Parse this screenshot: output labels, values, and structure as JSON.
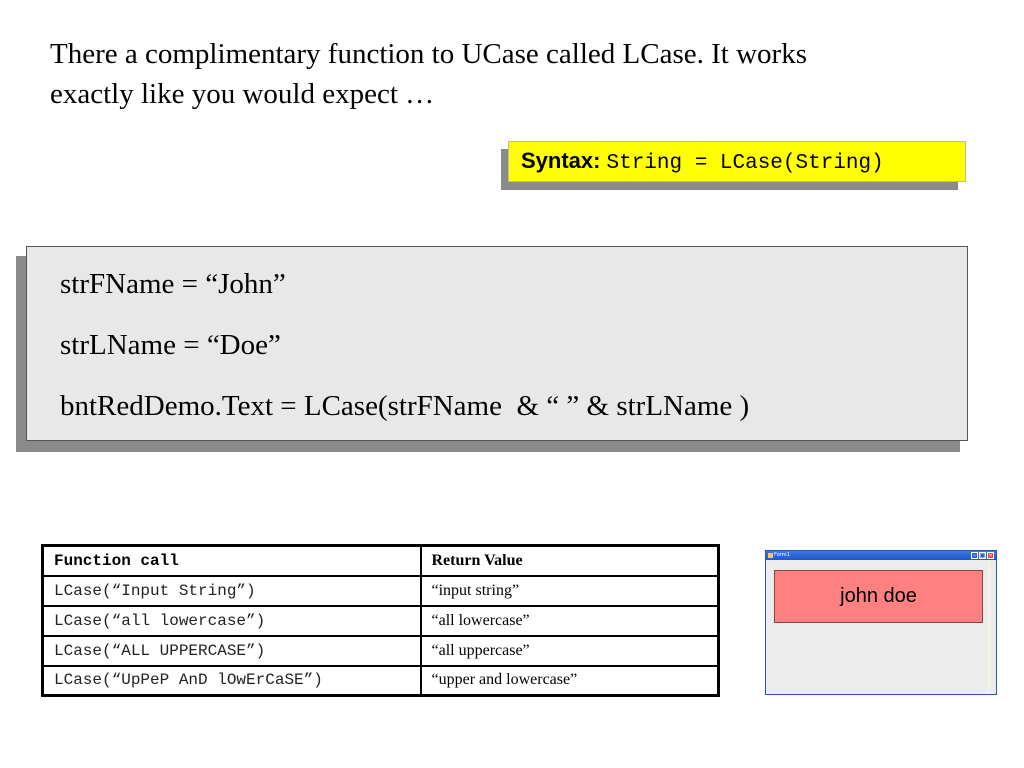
{
  "intro": {
    "line1": "There a complimentary function to UCase called LCase. It works",
    "line2": "exactly like you would expect …"
  },
  "syntax": {
    "label": "Syntax:",
    "code": "String = LCase(String)",
    "background_color": "#ffff00"
  },
  "code_example": {
    "lines": [
      "strFName = “John”",
      "strLName = “Doe”",
      "bntRedDemo.Text = LCase(strFName  & “ ” & strLName )"
    ]
  },
  "table": {
    "headers": [
      "Function call",
      "Return Value"
    ],
    "rows": [
      [
        "LCase(“Input String”)",
        "“input string”"
      ],
      [
        "LCase(“all lowercase”)",
        "“all lowercase”"
      ],
      [
        "LCase(“ALL UPPERCASE”)",
        "“all uppercase”"
      ],
      [
        "LCase(“UpPeP AnD lOwErCaSE”)",
        "“upper and lowercase”"
      ]
    ]
  },
  "demo_window": {
    "title": "Form1",
    "button_label": "john doe",
    "button_color": "#ff8080",
    "controls": {
      "minimize_icon": "minimize-icon",
      "maximize_icon": "maximize-icon",
      "close_icon": "close-icon"
    }
  }
}
